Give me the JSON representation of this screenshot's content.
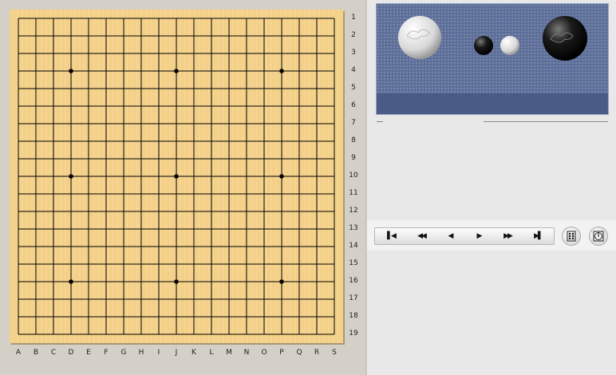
{
  "board": {
    "size": 19,
    "row_labels": [
      "1",
      "2",
      "3",
      "4",
      "5",
      "6",
      "7",
      "8",
      "9",
      "10",
      "11",
      "12",
      "13",
      "14",
      "15",
      "16",
      "17",
      "18",
      "19"
    ],
    "col_labels": [
      "A",
      "B",
      "C",
      "D",
      "E",
      "F",
      "G",
      "H",
      "I",
      "J",
      "K",
      "L",
      "M",
      "N",
      "O",
      "P",
      "Q",
      "R",
      "S"
    ],
    "star_points": [
      [
        "D",
        "4"
      ],
      [
        "J",
        "4"
      ],
      [
        "P",
        "4"
      ],
      [
        "D",
        "10"
      ],
      [
        "J",
        "10"
      ],
      [
        "P",
        "10"
      ],
      [
        "D",
        "16"
      ],
      [
        "J",
        "16"
      ],
      [
        "P",
        "16"
      ]
    ]
  },
  "navigation": {
    "first_icon": "first-move-icon",
    "back_fast_icon": "fast-back-icon",
    "back_icon": "back-icon",
    "forward_icon": "forward-icon",
    "forward_fast_icon": "fast-forward-icon",
    "last_icon": "last-move-icon"
  },
  "tools": {
    "left_icon": "board-coordinates-icon",
    "right_icon": "clock-icon"
  },
  "colors": {
    "board": "#f6d48f",
    "banner": "#5d6f99"
  }
}
